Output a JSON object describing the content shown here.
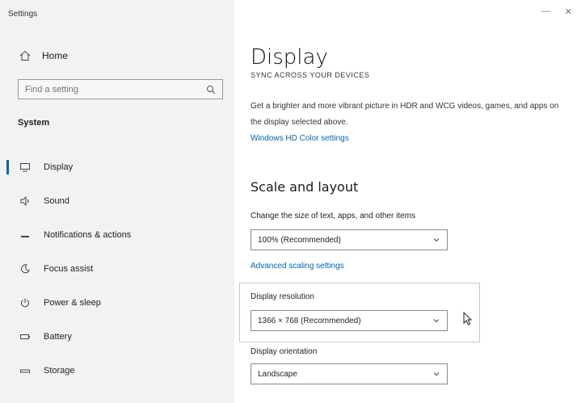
{
  "window": {
    "title": "Settings",
    "controls": [
      "—",
      "✕"
    ]
  },
  "sidebar": {
    "home_label": "Home",
    "search_placeholder": "Find a setting",
    "section_label": "System",
    "items": [
      {
        "label": "Display",
        "icon": "monitor-icon"
      },
      {
        "label": "Sound",
        "icon": "speaker-icon"
      },
      {
        "label": "Notifications & actions",
        "icon": "notifications-icon"
      },
      {
        "label": "Focus assist",
        "icon": "moon-icon"
      },
      {
        "label": "Power & sleep",
        "icon": "power-icon"
      },
      {
        "label": "Battery",
        "icon": "battery-icon"
      },
      {
        "label": "Storage",
        "icon": "storage-icon"
      }
    ],
    "active_index": 0
  },
  "main": {
    "title": "Display",
    "sync_note": "SYNC ACROSS YOUR DEVICES",
    "description": "Get a brighter and more vibrant picture in HDR and WCG videos, games, and apps on the display selected above.",
    "description_link": "Windows HD Color settings",
    "scale_section": {
      "heading": "Scale and layout",
      "scale_label": "Change the size of text, apps, and other items",
      "scale_value": "100% (Recommended)",
      "advanced_link": "Advanced scaling settings"
    },
    "resolution": {
      "label": "Display resolution",
      "value": "1366 × 768 (Recommended)"
    },
    "orientation": {
      "label": "Display orientation",
      "value": "Landscape"
    }
  },
  "colors": {
    "accent": "#0063b1",
    "sidebar_bg": "#f2f2f2"
  }
}
